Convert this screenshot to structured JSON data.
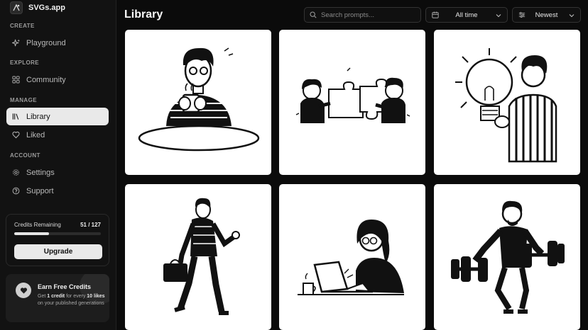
{
  "app": {
    "name": "SVGs.app"
  },
  "sidebar": {
    "sections": {
      "create": "CREATE",
      "explore": "EXPLORE",
      "manage": "MANAGE",
      "account": "ACCOUNT"
    },
    "items": {
      "playground": "Playground",
      "community": "Community",
      "library": "Library",
      "liked": "Liked",
      "settings": "Settings",
      "support": "Support"
    },
    "active_item": "Library"
  },
  "credits": {
    "label": "Credits Remaining",
    "count": "51 / 127",
    "remaining": 51,
    "total": 127,
    "upgrade_label": "Upgrade"
  },
  "earn": {
    "title": "Earn Free Credits",
    "text_1": "Get ",
    "text_bold_1": "1 credit",
    "text_2": " for every ",
    "text_bold_2": "10 likes",
    "text_3": " on your published generations"
  },
  "header": {
    "title": "Library",
    "search_placeholder": "Search prompts...",
    "time_filter": "All time",
    "sort": "Newest"
  },
  "gallery": [
    {
      "subject": "person drinking coffee at table"
    },
    {
      "subject": "two people joining puzzle pieces"
    },
    {
      "subject": "person holding light bulb"
    },
    {
      "subject": "man walking with briefcase"
    },
    {
      "subject": "woman working on laptop"
    },
    {
      "subject": "man lifting dumbbells"
    }
  ],
  "colors": {
    "background": "#0b0b0b",
    "sidebar": "#121212",
    "active": "#e9e9e9",
    "card": "#ffffff"
  }
}
